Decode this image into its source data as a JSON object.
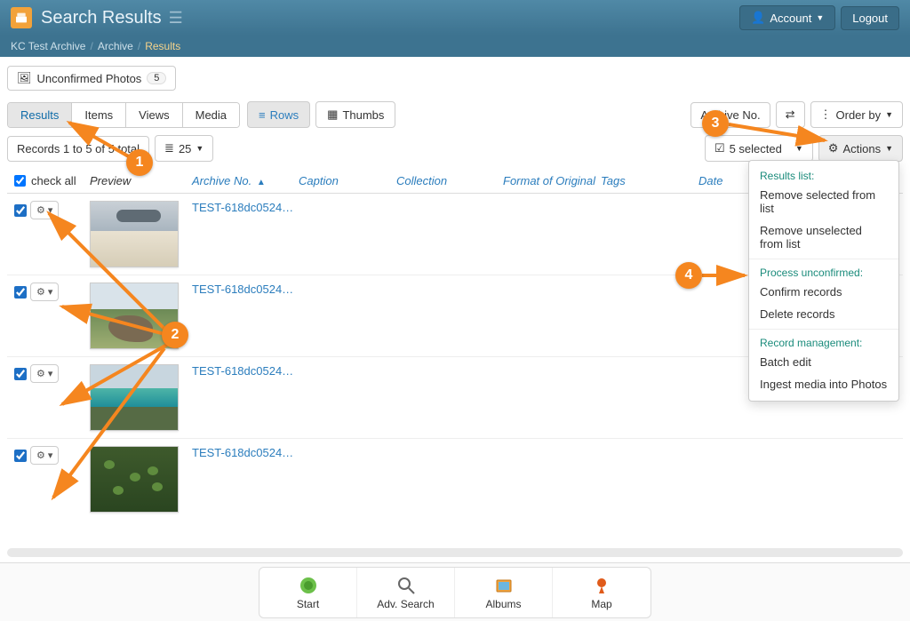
{
  "header": {
    "title": "Search Results",
    "account_label": "Account",
    "logout_label": "Logout"
  },
  "breadcrumb": {
    "root": "KC Test Archive",
    "mid": "Archive",
    "current": "Results"
  },
  "filter_tab": {
    "label": "Unconfirmed Photos",
    "count": "5"
  },
  "tabs": {
    "results": "Results",
    "items": "Items",
    "views": "Views",
    "media": "Media"
  },
  "view": {
    "rows": "Rows",
    "thumbs": "Thumbs"
  },
  "toolbar": {
    "archive_no": "Archive No.",
    "order_by": "Order by",
    "records_range": "Records 1 to 5 of 5 total",
    "page_size": "25",
    "selected": "5 selected",
    "actions": "Actions"
  },
  "columns": {
    "check_all": "check all",
    "preview": "Preview",
    "archive_no": "Archive No.",
    "caption": "Caption",
    "collection": "Collection",
    "format": "Format of Original",
    "tags": "Tags",
    "date": "Date"
  },
  "rows": [
    {
      "archive": "TEST-618dc0524…"
    },
    {
      "archive": "TEST-618dc0524…"
    },
    {
      "archive": "TEST-618dc0524…"
    },
    {
      "archive": "TEST-618dc0524…"
    }
  ],
  "dropdown": {
    "g1_title": "Results list:",
    "g1_items": [
      "Remove selected from list",
      "Remove unselected from list"
    ],
    "g2_title": "Process unconfirmed:",
    "g2_items": [
      "Confirm records",
      "Delete records"
    ],
    "g3_title": "Record management:",
    "g3_items": [
      "Batch edit",
      "Ingest media into Photos"
    ]
  },
  "dock": {
    "start": "Start",
    "adv": "Adv. Search",
    "albums": "Albums",
    "map": "Map"
  },
  "annotations": {
    "m1": "1",
    "m2": "2",
    "m3": "3",
    "m4": "4"
  }
}
